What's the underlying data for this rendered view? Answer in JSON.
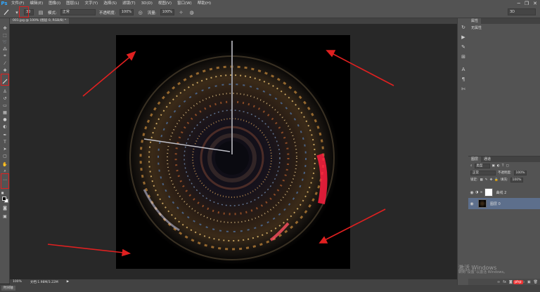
{
  "app": {
    "logo": "Ps"
  },
  "menu": [
    "文件(F)",
    "编辑(E)",
    "图像(I)",
    "图层(L)",
    "文字(Y)",
    "选择(S)",
    "滤镜(T)",
    "3D(D)",
    "视图(V)",
    "窗口(W)",
    "帮助(H)"
  ],
  "window_controls": {
    "minimize": "─",
    "restore": "❐",
    "close": "✕"
  },
  "options": {
    "brush_size": "30",
    "mode_label": "模式:",
    "mode_value": "正常",
    "opacity_label": "不透明度:",
    "opacity_value": "100%",
    "flow_label": "流量:",
    "flow_value": "100%",
    "workspace": "3D"
  },
  "document": {
    "tab": "001.jpg @ 100% (图层 0, RGB/8) *",
    "zoom": "100%",
    "info": "文档:1.98M/3.22M"
  },
  "properties": {
    "tab": "属性",
    "text": "无属性"
  },
  "layers_panel": {
    "tab_layers": "图层",
    "tab_channels": "通道",
    "kind_label": "类型",
    "blend_mode": "正常",
    "opacity_label": "不透明度:",
    "opacity_value": "100%",
    "lock_label": "锁定:",
    "fill_label": "填充:",
    "fill_value": "100%",
    "layers": [
      {
        "name": "曲线 2",
        "selected": false
      },
      {
        "name": "图层 0",
        "selected": true
      }
    ]
  },
  "bottom_tab": "时间轴",
  "watermark": {
    "title": "激活 Windows",
    "subtitle": "转到“设置”以激活 Windows。"
  },
  "badge": "php",
  "accent_colors": {
    "highlight": "#e02020",
    "selection": "#5d6f8c",
    "panel": "#535353"
  }
}
